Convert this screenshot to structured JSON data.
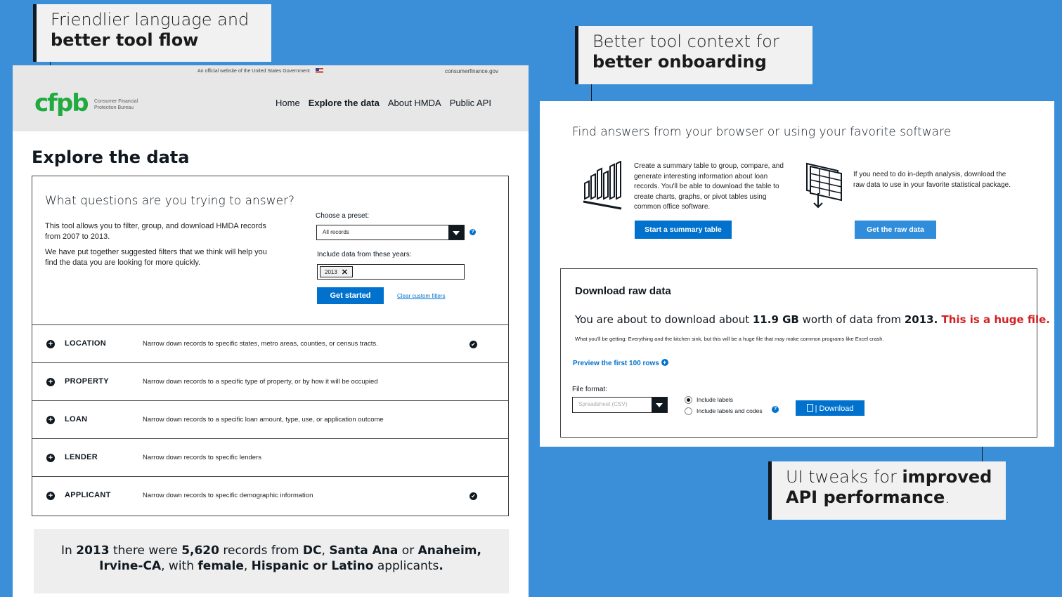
{
  "callouts": {
    "flow": {
      "normal": "Friendlier language and",
      "bold": "better tool flow"
    },
    "onboarding": {
      "normal": "Better tool context for",
      "bold": "better onboarding"
    },
    "api": {
      "normal": "UI tweaks for ",
      "bold": "improved API performance",
      "end": "."
    }
  },
  "header": {
    "official": "An official website of the United States Government",
    "domain": "consumerfinance.gov",
    "logo": "cfpb",
    "logo_text": "Consumer Financial Protection Bureau",
    "nav": [
      "Home",
      "Explore the data",
      "About HMDA",
      "Public API"
    ],
    "active_nav": "Explore the data"
  },
  "explore": {
    "title": "Explore the data",
    "question": "What questions are you trying to answer?",
    "intro1": "This tool allows you to filter, group, and download HMDA records from 2007 to 2013.",
    "intro2": "We have put together suggested filters that we think will help you find the data you are looking for more quickly.",
    "preset_label": "Choose a preset:",
    "preset_value": "All records",
    "years_label": "Include data from these years:",
    "year_tag": "2013",
    "get_started": "Get started",
    "clear_filters": "Clear custom filters"
  },
  "filters": [
    {
      "name": "LOCATION",
      "desc": "Narrow down records to specific states, metro areas, counties, or census tracts.",
      "checked": true
    },
    {
      "name": "PROPERTY",
      "desc": "Narrow down records to a specific type of property, or by how it will be occupied",
      "checked": false
    },
    {
      "name": "LOAN",
      "desc": "Narrow down records to a specific loan amount, type, use, or application outcome",
      "checked": false
    },
    {
      "name": "LENDER",
      "desc": "Narrow down records to specific lenders",
      "checked": false
    },
    {
      "name": "APPLICANT",
      "desc": "Narrow down records to specific demographic information",
      "checked": true
    }
  ],
  "summary": {
    "p1": "In ",
    "year": "2013",
    "p2": " there were ",
    "count": "5,620",
    "p3": " records from ",
    "loc1": "DC",
    "p4": ", ",
    "loc2": "Santa Ana",
    "p5": " or ",
    "loc3": "Anaheim,",
    "loc4": "Irvine-CA",
    "p6": ", with ",
    "gender": "female",
    "p7": ", ",
    "ethnicity": "Hispanic or Latino",
    "p8": " applicants",
    "end": "."
  },
  "onboarding": {
    "title": "Find answers from your browser or using your favorite software",
    "summary_text": "Create a summary table to group, compare, and generate interesting information about loan records. You'll be able to download the table to create charts, graphs, or pivot tables using common office software.",
    "summary_button": "Start a summary table",
    "raw_text": "If you need to do in-depth analysis, download the raw data to use in your favorite statistical package.",
    "raw_button": "Get the raw data"
  },
  "download": {
    "title": "Download raw data",
    "line_a": "You are about to download about ",
    "size": "11.9 GB",
    "line_b": " worth of data from ",
    "year": "2013.",
    "warning": " This is a huge file.",
    "small": "What you'll be getting: Everything and the kitchen sink, but this will be a huge file that may make common programs like Excel crash.",
    "preview": "Preview the first 100 rows",
    "file_format_label": "File format:",
    "format_placeholder": "Spreadsheet (CSV)",
    "radio1": "Include labels",
    "radio2": "Include labels and codes",
    "download_button": "| Download"
  },
  "colors": {
    "background": "#3a8fd8",
    "accent": "#0072ce",
    "brand": "#20aa3f",
    "warning": "#d12124"
  }
}
